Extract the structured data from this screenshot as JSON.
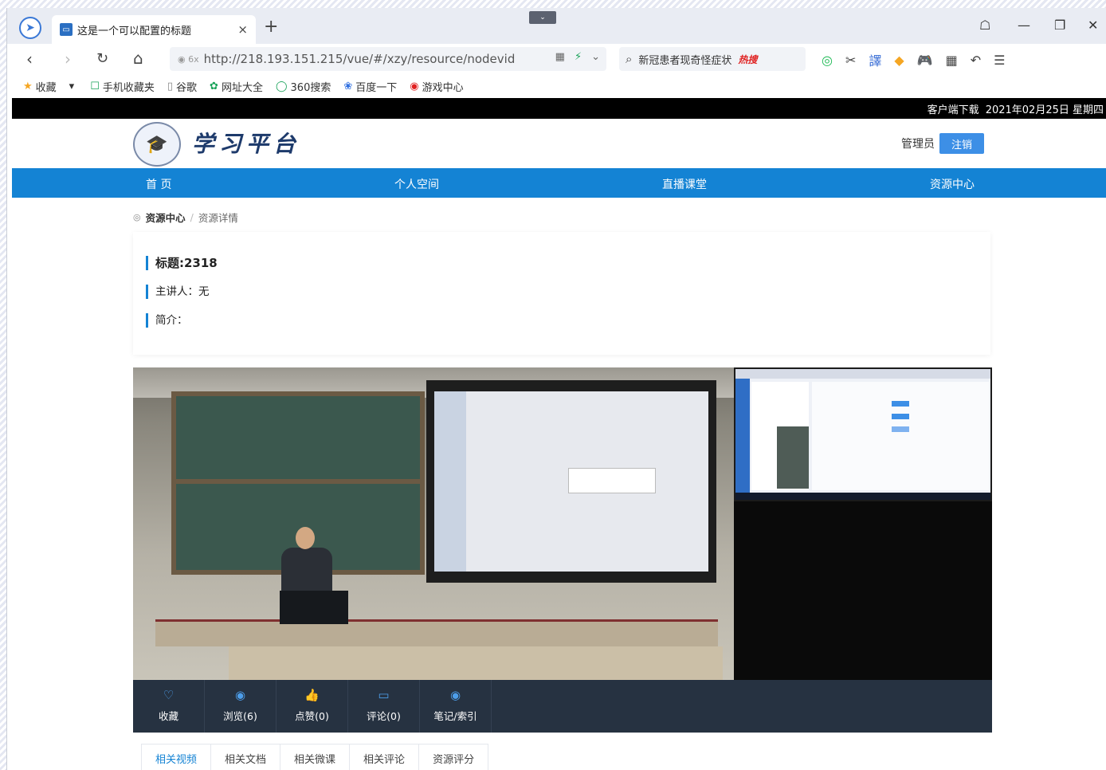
{
  "browser": {
    "tab": {
      "title": "这是一个可以配置的标题",
      "close": "×"
    },
    "new_tab": "+",
    "tab_list_toggle": "⌄",
    "window_controls": {
      "skin": "☖",
      "minimize": "—",
      "restore": "❐",
      "close": "✕"
    },
    "nav": {
      "back": "‹",
      "forward": "›",
      "reload": "↻",
      "home": "⌂"
    },
    "url": {
      "lock": "◉ 6x",
      "value": "http://218.193.151.215/vue/#/xzy/resource/nodevid",
      "tail": [
        "▦",
        "⚡",
        "⌄"
      ]
    },
    "search": {
      "icon": "⌕",
      "text": "新冠患者现奇怪症状",
      "hot": "热搜"
    },
    "toolbar_icons": [
      "◎",
      "✂",
      "譯",
      "◆",
      "🎮",
      "▦",
      "↶",
      "☰"
    ],
    "bookmarks": [
      {
        "icon": "★",
        "label": "收藏"
      },
      {
        "icon": "▾",
        "label": ""
      },
      {
        "icon": "☐",
        "label": "手机收藏夹"
      },
      {
        "icon": "▯",
        "label": "谷歌"
      },
      {
        "icon": "✿",
        "label": "网址大全"
      },
      {
        "icon": "◯",
        "label": "360搜索"
      },
      {
        "icon": "❀",
        "label": "百度一下"
      },
      {
        "icon": "◉",
        "label": "游戏中心"
      }
    ]
  },
  "site": {
    "topstrip": {
      "download": "客户端下载",
      "date": "2021年02月25日 星期四"
    },
    "logo_title": "学习平台",
    "user": {
      "role": "管理员",
      "logout": "注销"
    },
    "nav": [
      "首 页",
      "个人空间",
      "直播课堂",
      "资源中心"
    ],
    "breadcrumb": {
      "pin": "◎",
      "first": "资源中心",
      "sep": "/",
      "current": "资源详情"
    },
    "info": {
      "title": "标题:2318",
      "speaker": "主讲人：无",
      "intro": "简介："
    },
    "actions": [
      {
        "icon": "♡",
        "label": "收藏"
      },
      {
        "icon": "◉",
        "label": "浏览(6)"
      },
      {
        "icon": "👍",
        "label": "点赞(0)"
      },
      {
        "icon": "▭",
        "label": "评论(0)"
      },
      {
        "icon": "◉",
        "label": "笔记/索引"
      }
    ],
    "sub_tabs": [
      "相关视频",
      "相关文档",
      "相关微课",
      "相关评论",
      "资源评分"
    ]
  },
  "colors": {
    "primary": "#1483d4",
    "action_bar": "#263241",
    "logout": "#3d8fe6"
  }
}
